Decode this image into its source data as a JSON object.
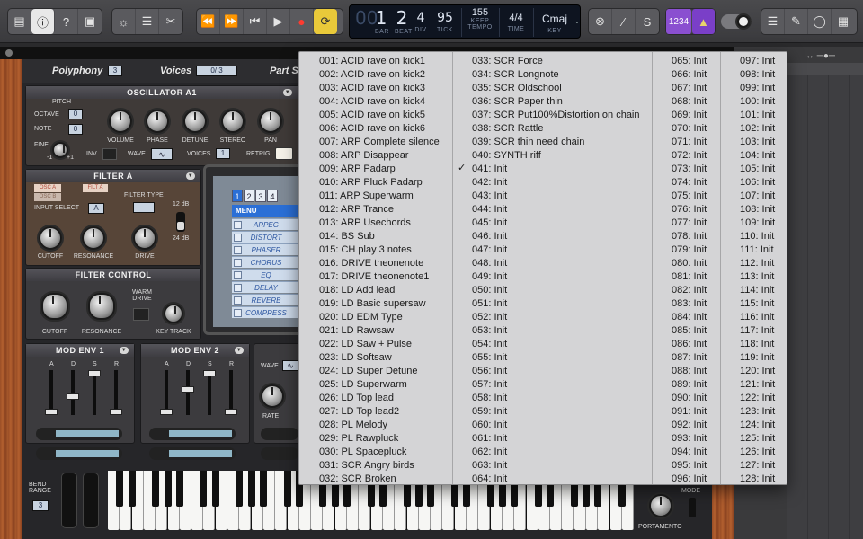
{
  "toolbar": {
    "left_icons": [
      "library-icon",
      "info-icon",
      "help-icon",
      "inbox-icon"
    ],
    "mid_icons": [
      "smart-controls-icon",
      "mixer-icon",
      "editors-icon"
    ],
    "transport_icons": [
      "rewind-icon",
      "fast-forward-icon",
      "go-to-beginning-icon",
      "play-icon",
      "record-icon",
      "cycle-icon"
    ],
    "lcd": {
      "bar": "1",
      "beat": "2",
      "div": "4",
      "tick": "95",
      "tempo": "155",
      "tempo_mode": "KEEP",
      "time_sig": "4/4",
      "key": "Cmaj",
      "labels": {
        "bar": "BAR",
        "beat": "BEAT",
        "div": "DIV",
        "tick": "TICK",
        "tempo": "TEMPO",
        "time": "TIME",
        "key": "KEY"
      }
    },
    "count_in": "1234",
    "right_icons": [
      "list-editors-icon",
      "note-pad-icon",
      "loop-browser-icon",
      "browsers-icon"
    ]
  },
  "synth": {
    "polyphony_label": "Polyphony",
    "polyphony_value": "3",
    "voices_label": "Voices",
    "voices_value": "0/ 3",
    "part_label": "Part S",
    "osc_panel_title": "OSCILLATOR A1",
    "pitch_label": "PITCH",
    "octave_label": "OCTAVE",
    "octave_value": "0",
    "note_label": "NOTE",
    "note_value": "0",
    "fine_label": "FINE",
    "fine_range_low": "-1",
    "fine_range_high": "+1",
    "knob_labels": [
      "VOLUME",
      "PHASE",
      "DETUNE",
      "STEREO",
      "PAN"
    ],
    "inv_label": "INV",
    "wave_label": "WAVE",
    "voices_small_label": "VOICES",
    "voices_small_value": "1",
    "retrig_label": "RETRIG",
    "filter_panel_title": "FILTER A",
    "osc_a_label": "OSC A",
    "osc_b_label": "OSC B",
    "filt_a_label": "FILT A",
    "input_select_label": "INPUT SELECT",
    "input_select_value": "A",
    "filter_type_label": "FILTER TYPE",
    "db12_label": "12 dB",
    "db24_label": "24 dB",
    "filter_knobs": [
      "CUTOFF",
      "RESONANCE",
      "DRIVE"
    ],
    "filter_control_title": "FILTER CONTROL",
    "filter_control_knobs": [
      "CUTOFF",
      "RESONANCE",
      "KEY TRACK"
    ],
    "warm_drive_label": "WARM DRIVE",
    "fx_tabs": [
      "1",
      "2",
      "3",
      "4"
    ],
    "fx_menu_label": "MENU",
    "fx_items": [
      "ARPEG",
      "DISTORT",
      "PHASER",
      "CHORUS",
      "EQ",
      "DELAY",
      "REVERB",
      "COMPRESS"
    ],
    "mod_env1_title": "MOD ENV 1",
    "mod_env2_title": "MOD ENV 2",
    "adsr": [
      "A",
      "D",
      "S",
      "R"
    ],
    "wave2_label": "WAVE",
    "rate_label": "RATE",
    "bend_range_label": "BEND RANGE",
    "bend_range_value": "3",
    "mode_label": "MODE",
    "portamento_label": "PORTAMENTO"
  },
  "menu": {
    "checked": "041: Init",
    "col1": [
      "001: ACID rave on kick1",
      "002: ACID rave on kick2",
      "003: ACID rave on kick3",
      "004: ACID rave on kick4",
      "005: ACID rave on kick5",
      "006: ACID rave on kick6",
      "007: ARP Complete silence",
      "008: ARP Disappear",
      "009: ARP Padarp",
      "010: ARP Pluck Padarp",
      "011: ARP Superwarm",
      "012: ARP Trance",
      "013: ARP Usechords",
      "014: BS Sub",
      "015: CH play 3 notes",
      "016: DRIVE theonenote",
      "017: DRIVE theonenote1",
      "018: LD Add lead",
      "019: LD Basic supersaw",
      "020: LD EDM Type",
      "021: LD Rawsaw",
      "022: LD Saw + Pulse",
      "023: LD Softsaw",
      "024: LD Super Detune",
      "025: LD Superwarm",
      "026: LD Top lead",
      "027: LD Top lead2",
      "028: PL Melody",
      "029: PL Rawpluck",
      "030: PL Spacepluck",
      "031: SCR Angry birds",
      "032: SCR Broken"
    ],
    "col2": [
      "033: SCR Force",
      "034: SCR Longnote",
      "035: SCR Oldschool",
      "036: SCR Paper thin",
      "037: SCR Put100%Distortion on chain",
      "038: SCR Rattle",
      "039: SCR thin need chain",
      "040: SYNTH riff",
      "041: Init",
      "042: Init",
      "043: Init",
      "044: Init",
      "045: Init",
      "046: Init",
      "047: Init",
      "048: Init",
      "049: Init",
      "050: Init",
      "051: Init",
      "052: Init",
      "053: Init",
      "054: Init",
      "055: Init",
      "056: Init",
      "057: Init",
      "058: Init",
      "059: Init",
      "060: Init",
      "061: Init",
      "062: Init",
      "063: Init",
      "064: Init"
    ],
    "col3": [
      "065: Init",
      "066: Init",
      "067: Init",
      "068: Init",
      "069: Init",
      "070: Init",
      "071: Init",
      "072: Init",
      "073: Init",
      "074: Init",
      "075: Init",
      "076: Init",
      "077: Init",
      "078: Init",
      "079: Init",
      "080: Init",
      "081: Init",
      "082: Init",
      "083: Init",
      "084: Init",
      "085: Init",
      "086: Init",
      "087: Init",
      "088: Init",
      "089: Init",
      "090: Init",
      "091: Init",
      "092: Init",
      "093: Init",
      "094: Init",
      "095: Init",
      "096: Init"
    ],
    "col4": [
      "097: Init",
      "098: Init",
      "099: Init",
      "100: Init",
      "101: Init",
      "102: Init",
      "103: Init",
      "104: Init",
      "105: Init",
      "106: Init",
      "107: Init",
      "108: Init",
      "109: Init",
      "110: Init",
      "111: Init",
      "112: Init",
      "113: Init",
      "114: Init",
      "115: Init",
      "116: Init",
      "117: Init",
      "118: Init",
      "119: Init",
      "120: Init",
      "121: Init",
      "122: Init",
      "123: Init",
      "124: Init",
      "125: Init",
      "126: Init",
      "127: Init",
      "128: Init"
    ]
  },
  "colors": {
    "accent": "#2b6fd6",
    "cycle": "#e9c93a",
    "record": "#ff3b30",
    "count_in": "#8a4fd0"
  }
}
